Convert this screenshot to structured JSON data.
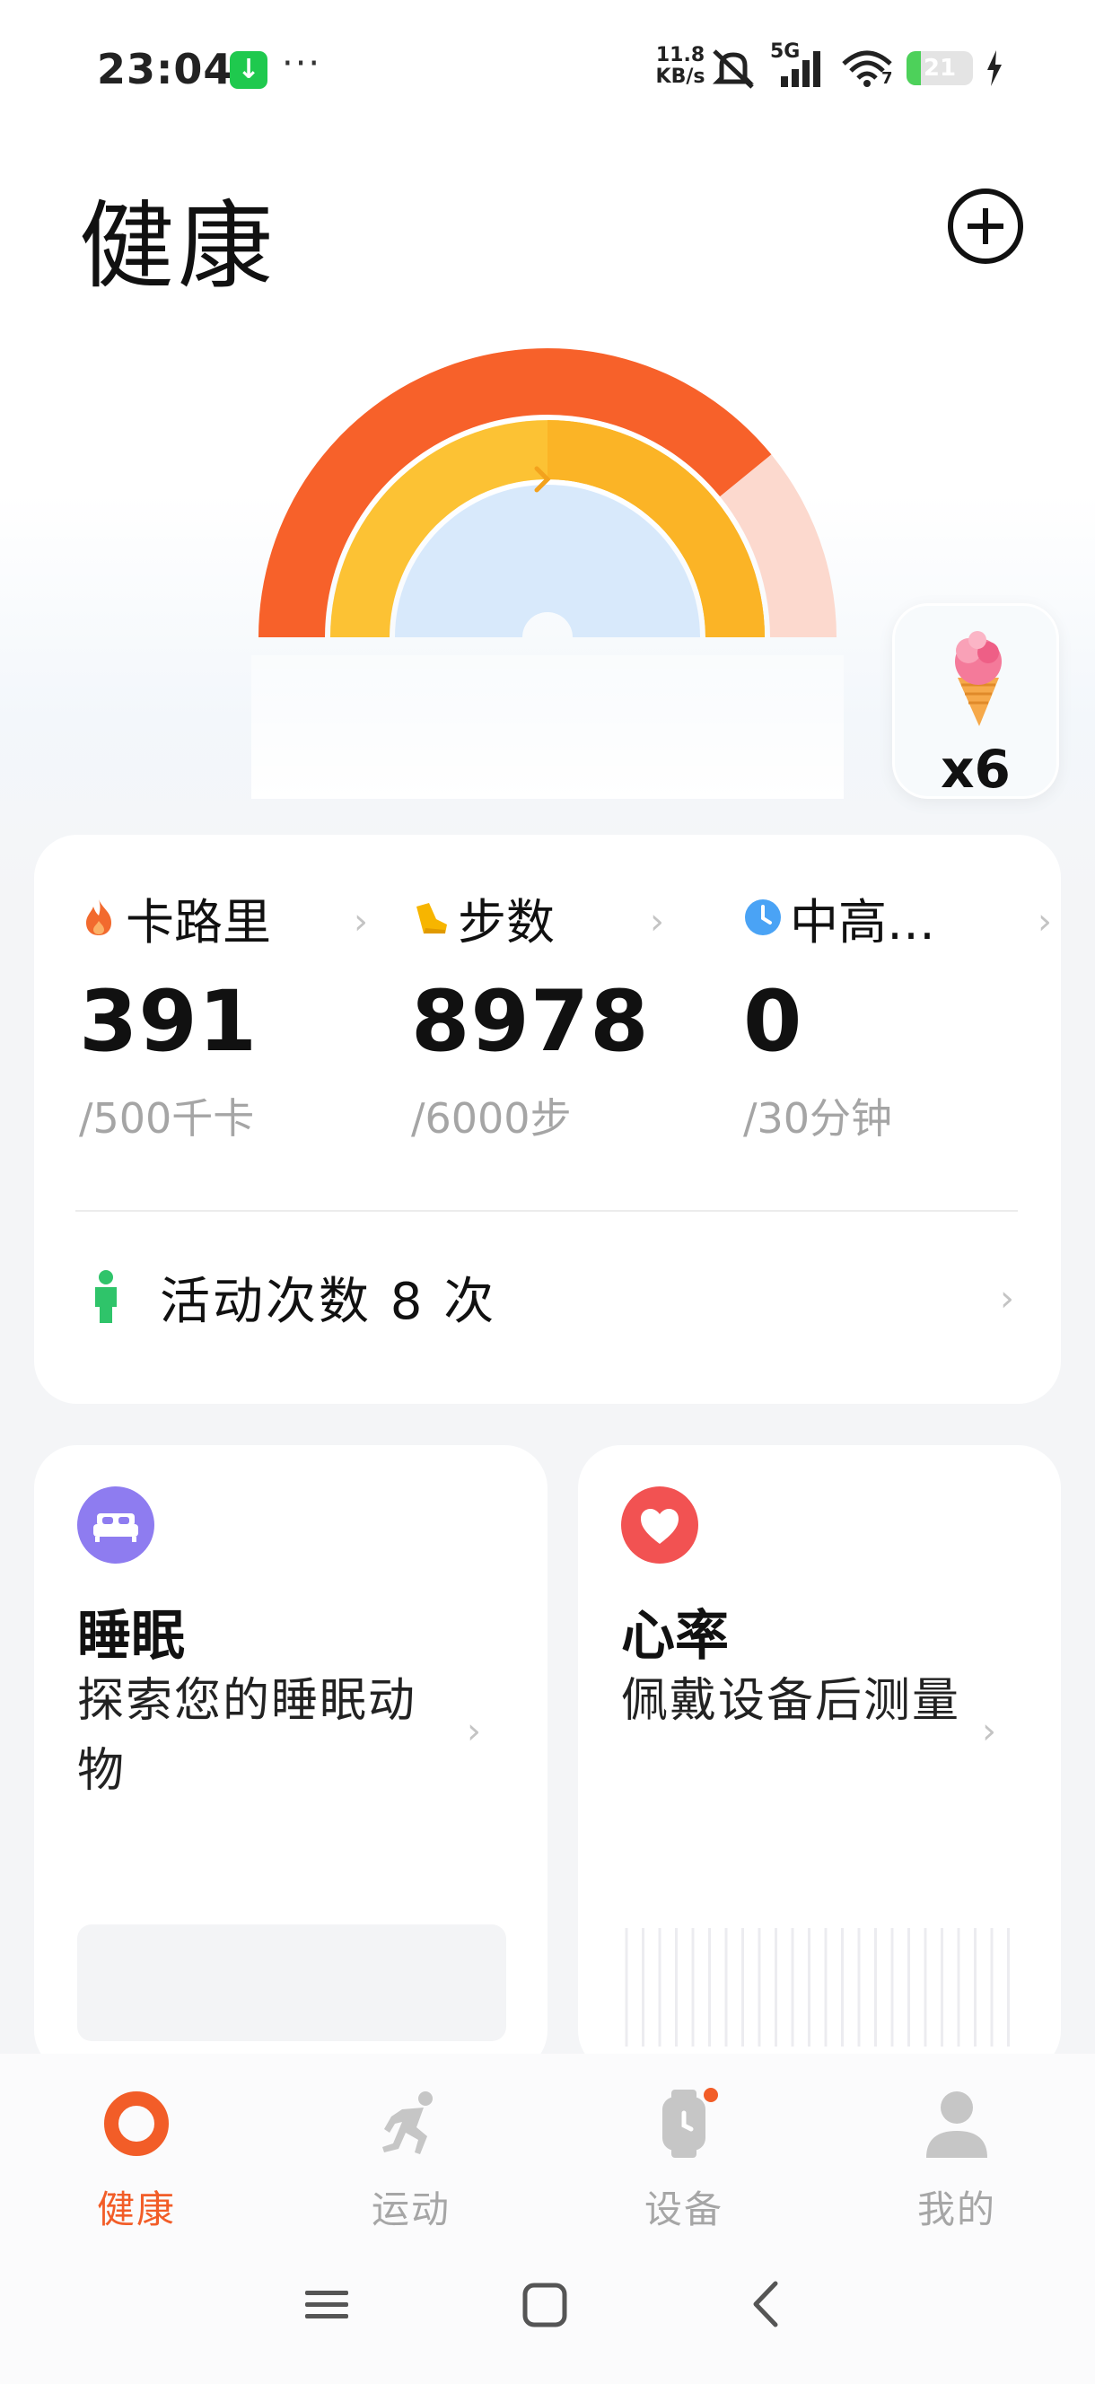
{
  "status_bar": {
    "time": "23:04",
    "more": "···",
    "net_speed_value": "11.8",
    "net_speed_unit": "KB/s",
    "network_type": "5G",
    "wifi_badge": "7",
    "battery_level": "21"
  },
  "header": {
    "title": "健康"
  },
  "reward": {
    "count": "x6"
  },
  "metrics": [
    {
      "title": "卡路里",
      "value": "391",
      "goal": "/500千卡",
      "icon": "flame-icon",
      "color": "#f26a2e"
    },
    {
      "title": "步数",
      "value": "8978",
      "goal": "/6000步",
      "icon": "shoe-icon",
      "color": "#f7b500"
    },
    {
      "title": "中高…",
      "value": "0",
      "goal": "/30分钟",
      "icon": "clock-icon",
      "color": "#4aa3f5"
    }
  ],
  "activity": {
    "label": "活动次数 8 次",
    "color": "#2fc46a"
  },
  "sleep_card": {
    "title": "睡眠",
    "description": "探索您的睡眠动物",
    "icon_color": "#8e7cf0"
  },
  "heart_card": {
    "title": "心率",
    "description": "佩戴设备后测量",
    "icon_color": "#f25252"
  },
  "bottom_nav": [
    {
      "label": "健康",
      "icon": "health-ring-icon",
      "active": true
    },
    {
      "label": "运动",
      "icon": "runner-icon",
      "active": false
    },
    {
      "label": "设备",
      "icon": "watch-icon",
      "active": false
    },
    {
      "label": "我的",
      "icon": "person-icon",
      "active": false
    }
  ],
  "gauge": {
    "calories_progress": 0.782,
    "steps_progress": 1.0,
    "intensity_progress": 0.0,
    "colors": {
      "calories": "#f7612a",
      "calories_track": "#fcd9ce",
      "steps": "#fcc234",
      "intensity": "#d8e9fb"
    }
  }
}
